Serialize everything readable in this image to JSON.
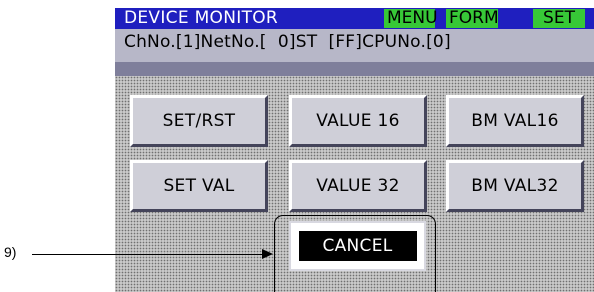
{
  "header": {
    "title": "DEVICE MONITOR",
    "menu_label": "MENU",
    "form_label": "FORM",
    "set_label": "SET"
  },
  "status": {
    "text": "ChNo.[1]NetNo.[  0]ST  [FF]CPUNo.[0]"
  },
  "buttons": {
    "set_rst": "SET/RST",
    "value16": "VALUE 16",
    "bm_val16": "BM VAL16",
    "set_val": "SET VAL",
    "value32": "VALUE 32",
    "bm_val32": "BM VAL32",
    "cancel": "CANCEL"
  },
  "annotation": {
    "label": "9)"
  },
  "colors": {
    "title_bar": "#1f1fbf",
    "menu_button": "#37c837",
    "info_bar": "#b7b7c8"
  }
}
